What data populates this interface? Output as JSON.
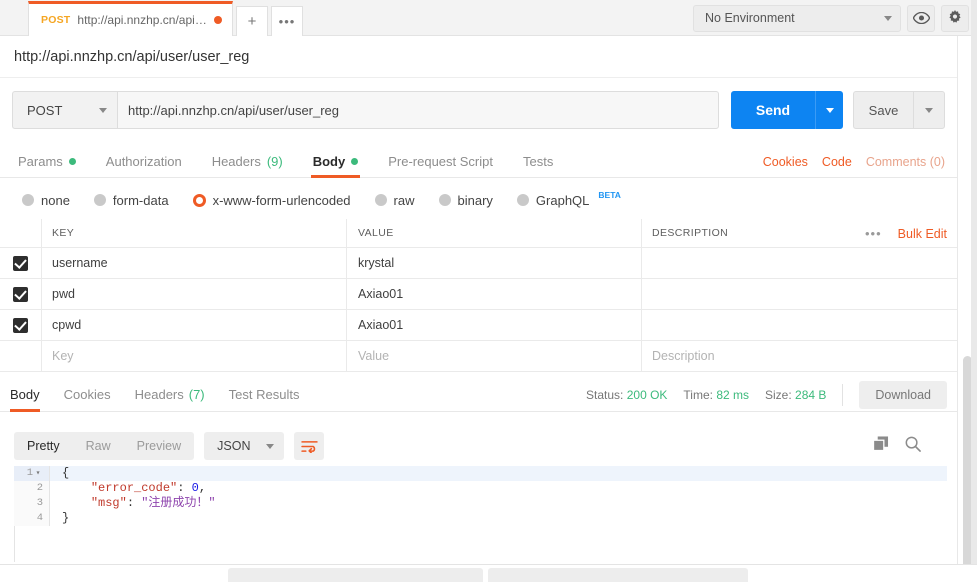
{
  "topbar": {
    "tab": {
      "method": "POST",
      "title": "http://api.nnzhp.cn/api/user/u...",
      "unsaved_icon": "dot-icon"
    },
    "new_tab_label": "+",
    "more_tabs_label": "•••",
    "environment": {
      "selected": "No Environment",
      "eye_icon": "eye-icon",
      "gear_icon": "gear-icon"
    }
  },
  "request": {
    "title_url": "http://api.nnzhp.cn/api/user/user_reg",
    "method": "POST",
    "url": "http://api.nnzhp.cn/api/user/user_reg",
    "send_label": "Send",
    "save_label": "Save",
    "tabs": [
      {
        "label": "Params",
        "dot": true
      },
      {
        "label": "Authorization",
        "dot": false
      },
      {
        "label": "Headers",
        "count": "(9)"
      },
      {
        "label": "Body",
        "dot": true,
        "active": true
      },
      {
        "label": "Pre-request Script"
      },
      {
        "label": "Tests"
      }
    ],
    "actions": {
      "cookies": "Cookies",
      "code": "Code",
      "comments": "Comments (0)"
    },
    "body_types": [
      {
        "label": "none",
        "selected": false
      },
      {
        "label": "form-data",
        "selected": false
      },
      {
        "label": "x-www-form-urlencoded",
        "selected": true
      },
      {
        "label": "raw",
        "selected": false
      },
      {
        "label": "binary",
        "selected": false
      },
      {
        "label": "GraphQL",
        "selected": false,
        "badge": "BETA"
      }
    ],
    "table": {
      "headers": {
        "key": "KEY",
        "value": "VALUE",
        "description": "DESCRIPTION"
      },
      "bulk_edit": "Bulk Edit",
      "more": "•••",
      "rows": [
        {
          "checked": true,
          "key": "username",
          "value": "krystal",
          "description": ""
        },
        {
          "checked": true,
          "key": "pwd",
          "value": "Axiao01",
          "description": ""
        },
        {
          "checked": true,
          "key": "cpwd",
          "value": "Axiao01",
          "description": ""
        }
      ],
      "placeholder_row": {
        "key": "Key",
        "value": "Value",
        "description": "Description"
      }
    }
  },
  "response": {
    "tabs": [
      {
        "label": "Body",
        "active": true
      },
      {
        "label": "Cookies"
      },
      {
        "label": "Headers",
        "count": "(7)"
      },
      {
        "label": "Test Results"
      }
    ],
    "status_label": "Status:",
    "status_value": "200 OK",
    "time_label": "Time:",
    "time_value": "82 ms",
    "size_label": "Size:",
    "size_value": "284 B",
    "download_label": "Download",
    "format_tabs": [
      {
        "label": "Pretty",
        "active": true
      },
      {
        "label": "Raw",
        "active": false
      },
      {
        "label": "Preview",
        "active": false
      }
    ],
    "language": "JSON",
    "wrap_icon": "word-wrap-icon",
    "copy_icon": "copy-icon",
    "search_icon": "search-icon",
    "body_lines": [
      {
        "num": "1",
        "fold": "▾",
        "text": "{",
        "highlight": true
      },
      {
        "num": "2",
        "key": "\"error_code\"",
        "colon": ": ",
        "value": "0",
        "value_type": "number",
        "suffix": ","
      },
      {
        "num": "3",
        "key": "\"msg\"",
        "colon": ": ",
        "value": "\"注册成功！\"",
        "value_type": "string"
      },
      {
        "num": "4",
        "text": "}"
      }
    ]
  },
  "colors": {
    "accent_orange": "#ef5b25",
    "send_blue": "#0d84f2",
    "green": "#3cba7c",
    "beta_blue": "#2196f3"
  }
}
